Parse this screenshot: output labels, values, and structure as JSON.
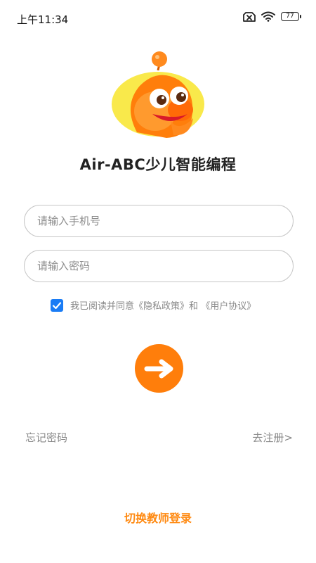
{
  "status_bar": {
    "time": "上午11:34",
    "battery": "77",
    "icons": [
      "no-sim-icon",
      "wifi-icon",
      "battery-icon"
    ]
  },
  "app": {
    "title": "Air-ABC少儿智能编程",
    "mascot": "mascot-logo"
  },
  "login_form": {
    "phone_placeholder": "请输入手机号",
    "password_placeholder": "请输入密码",
    "agreement": {
      "checked": true,
      "prefix": "我已阅读并同意",
      "privacy_link": "《隐私政策》",
      "conjunction": "和",
      "user_link": "《用户协议》"
    },
    "submit_icon": "arrow-right-icon"
  },
  "links": {
    "forgot_password": "忘记密码",
    "register": "去注册>",
    "switch_teacher": "切换教师登录"
  },
  "colors": {
    "accent": "#ff7e0b",
    "checkbox": "#1a7cf5",
    "text_muted": "#888888"
  }
}
